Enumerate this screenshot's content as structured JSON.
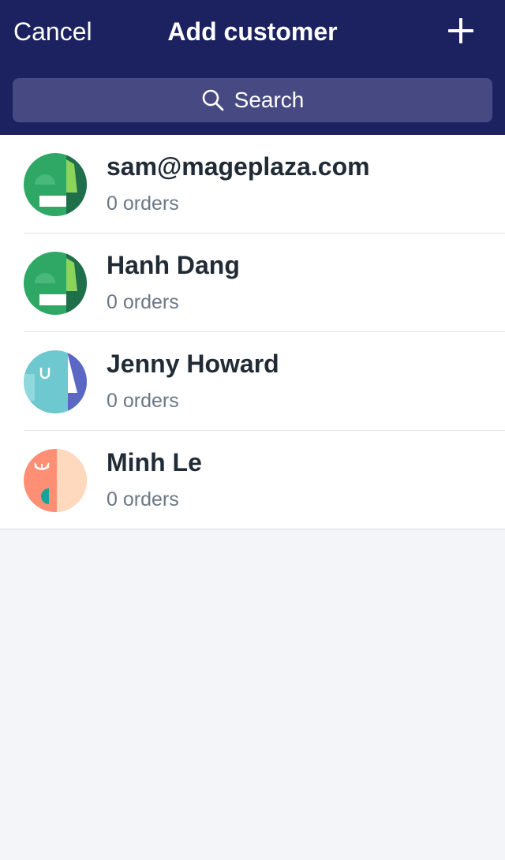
{
  "header": {
    "cancel_label": "Cancel",
    "title": "Add customer",
    "add_icon": "plus-icon",
    "background_color": "#1c2260"
  },
  "search": {
    "placeholder": "Search",
    "icon": "search-icon"
  },
  "customers": [
    {
      "name": "sam@mageplaza.com",
      "orders": "0 orders",
      "avatar": "green-face-avatar"
    },
    {
      "name": "Hanh Dang",
      "orders": "0 orders",
      "avatar": "green-face-avatar"
    },
    {
      "name": "Jenny Howard",
      "orders": "0 orders",
      "avatar": "teal-face-avatar"
    },
    {
      "name": "Minh Le",
      "orders": "0 orders",
      "avatar": "orange-face-avatar"
    }
  ]
}
